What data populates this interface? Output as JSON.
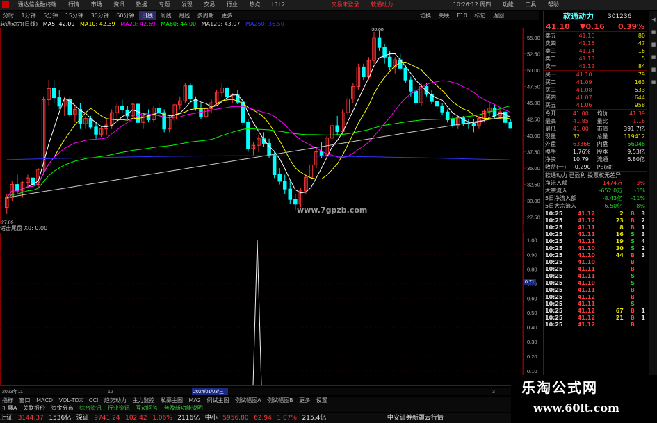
{
  "top_menu": {
    "app_title": "通达信金融终端",
    "items": [
      "行情",
      "市场",
      "资讯",
      "数据",
      "专题",
      "发现",
      "交易",
      "行业",
      "热点",
      "L1L2"
    ],
    "login_status": "交易未登录",
    "stock_name": "软通动力",
    "time": "10:26:12 周四",
    "right_items": [
      "功能",
      "工具",
      "帮助"
    ]
  },
  "period_bar": {
    "items": [
      "分时",
      "1分钟",
      "5分钟",
      "15分钟",
      "30分钟",
      "60分钟",
      "日线",
      "周线",
      "月线",
      "多周期",
      "更多"
    ],
    "active": "日线"
  },
  "tool_right": [
    "切换",
    "关联",
    "F10",
    "标记",
    "返回"
  ],
  "ma_legend": {
    "title": "软通动力(日线)",
    "items": [
      {
        "label": "MA5: 42.09",
        "color": "#ffffff"
      },
      {
        "label": "MA10: 42.39",
        "color": "#ffff00"
      },
      {
        "label": "MA20: 42.69",
        "color": "#ff00ff"
      },
      {
        "label": "MA60: 44.00",
        "color": "#00ff00"
      },
      {
        "label": "MA120: 43.07",
        "color": "#cccccc"
      },
      {
        "label": "MA250: 36.50",
        "color": "#3333ff"
      }
    ]
  },
  "chart_data": {
    "type": "candlestick",
    "price_axis": {
      "ticks": [
        "55.00",
        "52.50",
        "50.00",
        "47.50",
        "45.00",
        "42.50",
        "40.00",
        "37.50",
        "35.00",
        "32.50",
        "30.00",
        "27.50"
      ],
      "min": 26.5,
      "max": 56.5
    },
    "annotations": {
      "high": "55.88",
      "low": "27.09"
    },
    "candles": [
      [
        29,
        31,
        28,
        30.5
      ],
      [
        30.5,
        33,
        30,
        32.5
      ],
      [
        32.5,
        34,
        31,
        31.5
      ],
      [
        31.5,
        33,
        30.5,
        32.8
      ],
      [
        32.8,
        34,
        32,
        33.5
      ],
      [
        33.5,
        34.5,
        32,
        32.5
      ],
      [
        32.5,
        35,
        32,
        34.8
      ],
      [
        34.8,
        46,
        34,
        45.5
      ],
      [
        45.5,
        48.5,
        44.5,
        47.2
      ],
      [
        47.2,
        48.5,
        45,
        45.8
      ],
      [
        45.8,
        47,
        44,
        44.5
      ],
      [
        44.5,
        46,
        43,
        45.6
      ],
      [
        45.6,
        46,
        42.8,
        43.2
      ],
      [
        43.2,
        44.5,
        42,
        44
      ],
      [
        44,
        45,
        41,
        41.8
      ],
      [
        41.8,
        43,
        41,
        42.6
      ],
      [
        42.6,
        43,
        41,
        41.3
      ],
      [
        41.3,
        42,
        39.5,
        40.2
      ],
      [
        40.2,
        41.5,
        39.8,
        41
      ],
      [
        41,
        42.5,
        40,
        41.6
      ],
      [
        41.6,
        44,
        41,
        43.5
      ],
      [
        43.5,
        45,
        42.5,
        44.5
      ],
      [
        44.5,
        45.5,
        43.5,
        43.9
      ],
      [
        43.9,
        44.5,
        42.5,
        43
      ],
      [
        43,
        45,
        42.8,
        44.8
      ],
      [
        44.8,
        45,
        41.5,
        42
      ],
      [
        42,
        43.5,
        41,
        43
      ],
      [
        43,
        44,
        42,
        42.4
      ],
      [
        42.4,
        44.5,
        42,
        44.2
      ],
      [
        44.2,
        45,
        43,
        43.5
      ],
      [
        43.5,
        44,
        40.5,
        41
      ],
      [
        41,
        43,
        40.5,
        42.5
      ],
      [
        42.5,
        45,
        42,
        44.7
      ],
      [
        44.7,
        46,
        44,
        45.3
      ],
      [
        45.3,
        48,
        45,
        47.6
      ],
      [
        47.6,
        48,
        45,
        45.6
      ],
      [
        45.6,
        46,
        43.8,
        44.2
      ],
      [
        44.2,
        45,
        42.5,
        42.9
      ],
      [
        42.9,
        44.5,
        42.5,
        44.1
      ],
      [
        44.1,
        45.5,
        43.5,
        45
      ],
      [
        45,
        47,
        44.5,
        46.6
      ],
      [
        46.6,
        48,
        46,
        47.3
      ],
      [
        47.3,
        47.5,
        45.5,
        45.9
      ],
      [
        45.9,
        46.5,
        45,
        46.2
      ],
      [
        46.2,
        47,
        44.8,
        45.1
      ],
      [
        45.1,
        45.5,
        41.5,
        42
      ],
      [
        42,
        42.5,
        37.5,
        38
      ],
      [
        38,
        39,
        37,
        38.5
      ],
      [
        38.5,
        40,
        37.5,
        39.5
      ],
      [
        39.5,
        40.5,
        38.2,
        38.8
      ],
      [
        38.8,
        39.5,
        36.5,
        37
      ],
      [
        37,
        37.5,
        33.5,
        34
      ],
      [
        34,
        35,
        32.5,
        33
      ],
      [
        33,
        34,
        31,
        31.8
      ],
      [
        31.8,
        33,
        29.5,
        30.2
      ],
      [
        30.2,
        31,
        28.5,
        29.5
      ],
      [
        29.5,
        32,
        29,
        31.5
      ],
      [
        31.5,
        34,
        31,
        33.6
      ],
      [
        33.6,
        36,
        33,
        35.5
      ],
      [
        35.5,
        38,
        35,
        37.5
      ],
      [
        37.5,
        39,
        36.5,
        37
      ],
      [
        37,
        40,
        36.5,
        39.6
      ],
      [
        39.6,
        42,
        39,
        41.5
      ],
      [
        41.5,
        43,
        40,
        40.6
      ],
      [
        40.6,
        44,
        40,
        43.5
      ],
      [
        43.5,
        46,
        43,
        45.6
      ],
      [
        45.6,
        48,
        45,
        47.5
      ],
      [
        47.5,
        51,
        47,
        50.5
      ],
      [
        50.5,
        51,
        48.5,
        49
      ],
      [
        49,
        52,
        48.5,
        51.5
      ],
      [
        51.5,
        55.88,
        51,
        55
      ],
      [
        55,
        56,
        53,
        53.5
      ],
      [
        53.5,
        54,
        51,
        52
      ],
      [
        52,
        53,
        50,
        50.5
      ],
      [
        50.5,
        52,
        49.5,
        51.6
      ],
      [
        51.6,
        52.5,
        50,
        50.3
      ],
      [
        50.3,
        50.8,
        48,
        48.5
      ],
      [
        48.5,
        49,
        46,
        46.8
      ],
      [
        46.8,
        47.5,
        44.5,
        45
      ],
      [
        45,
        48,
        44.5,
        47.5
      ],
      [
        47.5,
        48,
        46,
        46.3
      ],
      [
        46.3,
        47,
        44.8,
        45.2
      ],
      [
        45.2,
        46,
        44,
        44.5
      ],
      [
        44.5,
        45,
        43.2,
        43.6
      ],
      [
        43.6,
        44,
        42,
        42.4
      ],
      [
        42.4,
        43,
        41.2,
        41.6
      ],
      [
        41.6,
        43,
        41,
        42.7
      ],
      [
        42.7,
        43,
        41.5,
        41.9
      ],
      [
        41.9,
        42.5,
        41,
        41.8
      ],
      [
        41.8,
        42.5,
        40.5,
        41.5
      ],
      [
        41.5,
        43,
        41,
        42.6
      ],
      [
        42.6,
        44,
        42,
        43.7
      ],
      [
        43.7,
        45,
        43,
        44.2
      ],
      [
        44.2,
        44.8,
        42.5,
        43
      ],
      [
        43,
        44,
        42.5,
        43.6
      ],
      [
        43.6,
        44,
        41.5,
        42
      ],
      [
        42,
        42.5,
        41,
        41.1
      ]
    ],
    "sub_panel": {
      "label": "诸击尾盘  X0: 0.00",
      "ticks": [
        "1.00",
        "0.90",
        "0.80",
        "0.70",
        "0.60",
        "0.50",
        "0.40",
        "0.30",
        "0.20",
        "0.10"
      ],
      "spike_value": 1.0,
      "current": "0.71"
    },
    "time_axis": {
      "start": "2023年11",
      "mid": "12",
      "selected": "2024/01/03/三",
      "end": "3"
    }
  },
  "site_mark": "www.7gpzb.com",
  "right_panel": {
    "name": "软通动力",
    "code": "301236",
    "price": "41.10",
    "change": "▼0.16",
    "pct": "0.39%",
    "asks": [
      [
        "卖五",
        "41.16",
        "80"
      ],
      [
        "卖四",
        "41.15",
        "47"
      ],
      [
        "卖三",
        "41.14",
        "16"
      ],
      [
        "卖二",
        "41.13",
        "5"
      ],
      [
        "卖一",
        "41.12",
        "84"
      ]
    ],
    "bids": [
      [
        "买一",
        "41.10",
        "79"
      ],
      [
        "买二",
        "41.09",
        "163"
      ],
      [
        "买三",
        "41.08",
        "533"
      ],
      [
        "买四",
        "41.07",
        "644"
      ],
      [
        "买五",
        "41.06",
        "958"
      ]
    ],
    "stats": [
      [
        "今开",
        "41.00",
        "均价",
        "41.39"
      ],
      [
        "最高",
        "41.85",
        "量比",
        "1.16"
      ],
      [
        "最低",
        "41.00",
        "市值",
        "391.7亿"
      ],
      [
        "现量",
        "32",
        "总量",
        "119412"
      ],
      [
        "外盘",
        "63366",
        "内盘",
        "56046"
      ],
      [
        "换手",
        "1.76%",
        "股本",
        "9.53亿"
      ],
      [
        "净资",
        "10.79",
        "流通",
        "6.80亿"
      ],
      [
        "收益(一)",
        "-0.290",
        "PE(动)",
        ""
      ]
    ],
    "tags": "软通动力  已盈利  投票权无差异",
    "flows": [
      [
        "净流入额",
        "1474万",
        "3%"
      ],
      [
        "大宗流入",
        "-652.0万",
        "-1%"
      ],
      [
        "5日净流入额",
        "-8.43亿",
        "-11%"
      ],
      [
        "5日大宗流入",
        "-6.50亿",
        "-8%"
      ]
    ],
    "ticks": [
      [
        "10:25",
        "41.12",
        "2",
        "B",
        "3"
      ],
      [
        "10:25",
        "41.12",
        "23",
        "B",
        "2"
      ],
      [
        "10:25",
        "41.11",
        "8",
        "B",
        "1"
      ],
      [
        "10:25",
        "41.11",
        "16",
        "S",
        "3"
      ],
      [
        "10:25",
        "41.11",
        "19",
        "S",
        "4"
      ],
      [
        "10:25",
        "41.10",
        "30",
        "S",
        "2"
      ],
      [
        "10:25",
        "41.10",
        "44",
        "B",
        "3"
      ],
      [
        "10:25",
        "41.10",
        "",
        "B",
        ""
      ],
      [
        "10:25",
        "41.11",
        "",
        "B",
        ""
      ],
      [
        "10:25",
        "41.11",
        "",
        "S",
        ""
      ],
      [
        "10:25",
        "41.10",
        "",
        "S",
        ""
      ],
      [
        "10:25",
        "41.11",
        "",
        "B",
        ""
      ],
      [
        "10:25",
        "41.12",
        "",
        "B",
        ""
      ],
      [
        "10:25",
        "41.11",
        "",
        "S",
        ""
      ],
      [
        "10:25",
        "41.12",
        "67",
        "B",
        "1"
      ],
      [
        "10:25",
        "41.12",
        "21",
        "B",
        "1"
      ],
      [
        "10:25",
        "41.12",
        "",
        "B",
        ""
      ]
    ]
  },
  "tabs_bar": [
    "指标",
    "窗口",
    "MACD",
    "VOL-TDX",
    "CCI",
    "趋势动力",
    "主力监控",
    "私募主图",
    "MA2",
    "例试主图",
    "例试幅图A",
    "例试幅图B",
    "更多",
    "设置"
  ],
  "tabs_bar2": [
    "扩展A",
    "关联报价",
    "资金分布",
    "综合资讯",
    "行业资讯",
    "互动问答",
    "普及新功能说明"
  ],
  "status_bar": {
    "sh_label": "上证",
    "sh_val": "3144.37",
    "sh_amt": "1536亿",
    "sz_label": "深证",
    "sz_val": "9741.24",
    "sz_chg": "102.42",
    "sz_pct": "1.06%",
    "sz_amt": "2116亿",
    "zx_label": "中小",
    "zx_val": "5956.80",
    "zx_chg": "62.94",
    "zx_pct": "1.07%",
    "zx_amt": "215.4亿",
    "broker": "中安证券新疆云行情"
  },
  "watermark": {
    "title": "乐淘公式网",
    "url": "www.60lt.com"
  },
  "colors": {
    "up": "#ff3a3a",
    "down": "#00ffff",
    "ma5": "#ffffff",
    "ma10": "#ffff00",
    "ma20": "#ff00ff",
    "ma60": "#00ff00",
    "ma120": "#cccccc",
    "ma250": "#3333ff"
  }
}
